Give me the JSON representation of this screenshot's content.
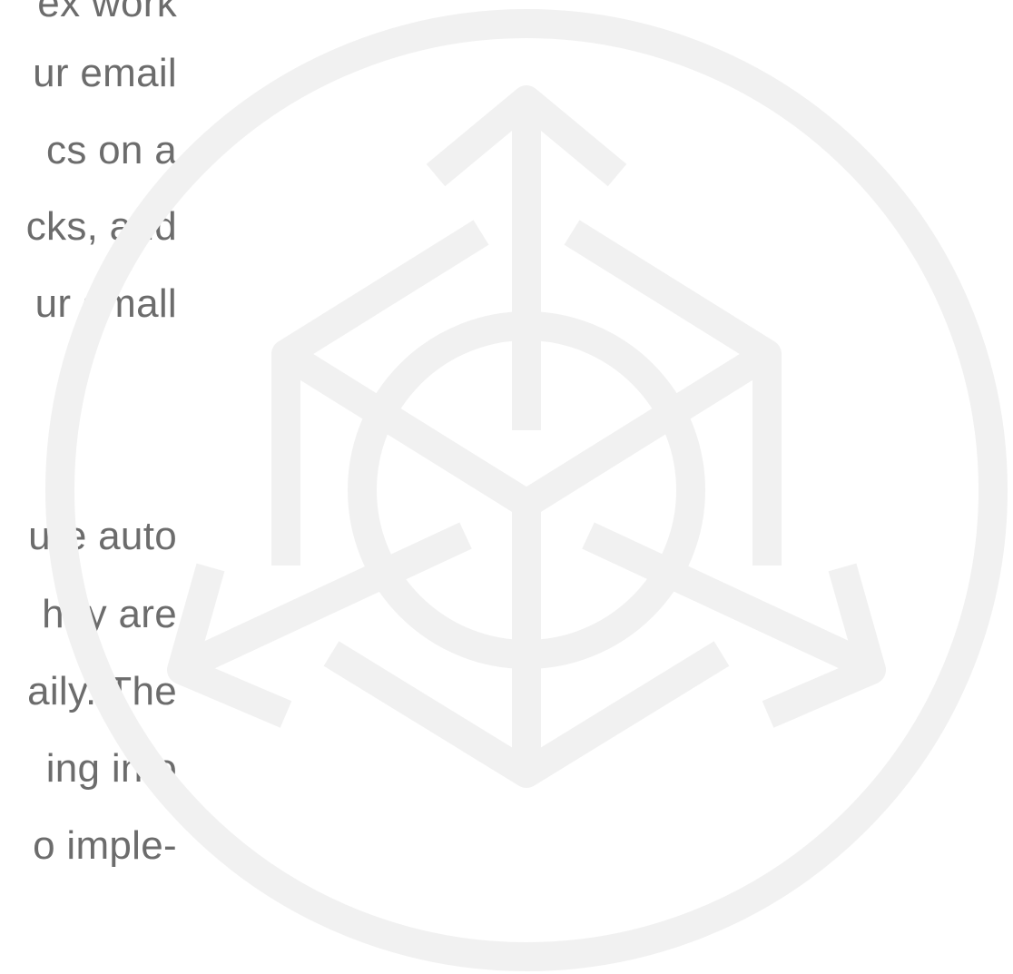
{
  "paragraph_1": {
    "lines": [
      "ex work",
      "ur email",
      "cs on a",
      "cks, and",
      "ur small"
    ]
  },
  "paragraph_2": {
    "lines": [
      "ure auto",
      "hey are",
      "aily. The",
      "ing into",
      "o imple-"
    ]
  },
  "illustration": {
    "icon": "cube-network-icon",
    "color": "#f1f1f1"
  }
}
